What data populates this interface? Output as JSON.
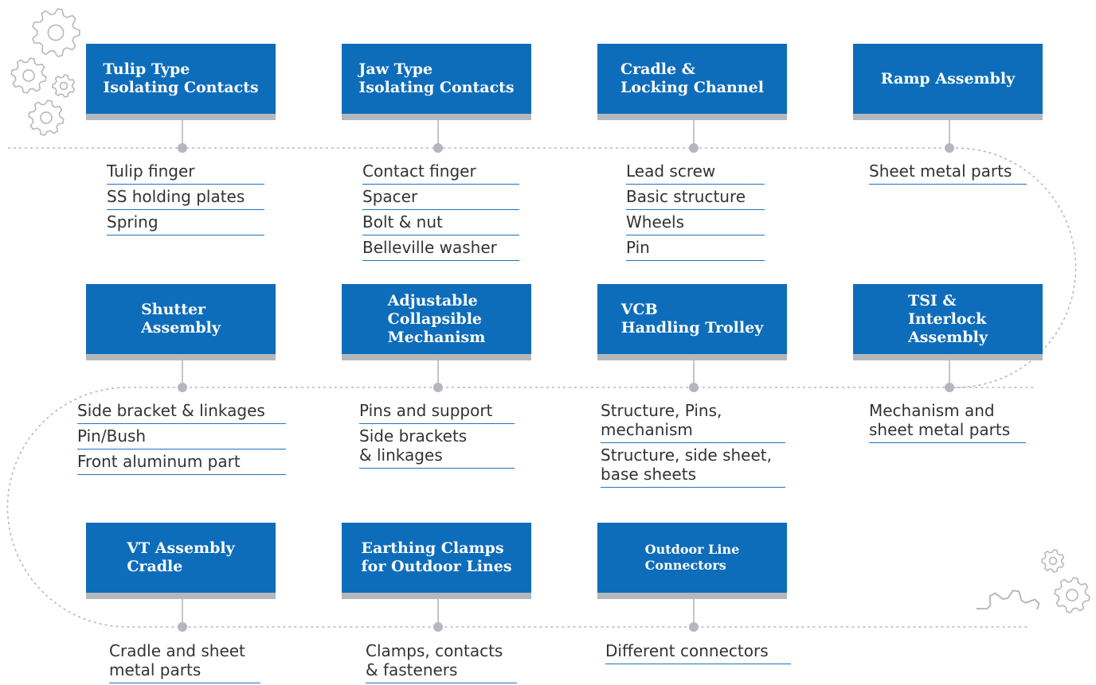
{
  "colors": {
    "box_fill": "#0e6dbb",
    "box_footer": "#b4b8bd",
    "connector": "#b4b8bd",
    "underline": "#1e73be",
    "text": "#333333",
    "gear": "#b8b8b8"
  },
  "decor": {
    "gears_top_left": "gears-icon",
    "gears_bottom_right": "gears-icon"
  },
  "rows": [
    {
      "cards": [
        {
          "title": "Tulip Type\nIsolating Contacts",
          "items": [
            "Tulip finger",
            "SS holding plates",
            "Spring"
          ]
        },
        {
          "title": "Jaw Type\nIsolating Contacts",
          "items": [
            "Contact finger",
            "Spacer",
            "Bolt & nut",
            "Belleville washer"
          ]
        },
        {
          "title": "Cradle &\nLocking Channel",
          "items": [
            "Lead screw",
            "Basic structure",
            "Wheels",
            "Pin"
          ]
        },
        {
          "title": "Ramp Assembly",
          "items": [
            "Sheet metal parts"
          ]
        }
      ]
    },
    {
      "cards": [
        {
          "title": "Shutter\nAssembly",
          "items": [
            "Side bracket & linkages",
            "Pin/Bush",
            "Front aluminum part"
          ]
        },
        {
          "title": "Adjustable\nCollapsible\nMechanism",
          "items": [
            "Pins and support",
            "Side brackets\n& linkages"
          ]
        },
        {
          "title": "VCB\nHandling Trolley",
          "items": [
            "Structure, Pins,\nmechanism",
            "Structure, side sheet,\nbase sheets"
          ]
        },
        {
          "title": "TSI &\nInterlock\nAssembly",
          "items": [
            "Mechanism and\nsheet metal parts"
          ]
        }
      ]
    },
    {
      "cards": [
        {
          "title": "VT Assembly\nCradle",
          "items": [
            "Cradle and sheet\nmetal parts"
          ]
        },
        {
          "title": "Earthing Clamps\nfor Outdoor Lines",
          "items": [
            "Clamps, contacts\n& fasteners"
          ]
        },
        {
          "title": "Outdoor Line\nConnectors",
          "items": [
            "Different connectors"
          ]
        }
      ]
    }
  ]
}
